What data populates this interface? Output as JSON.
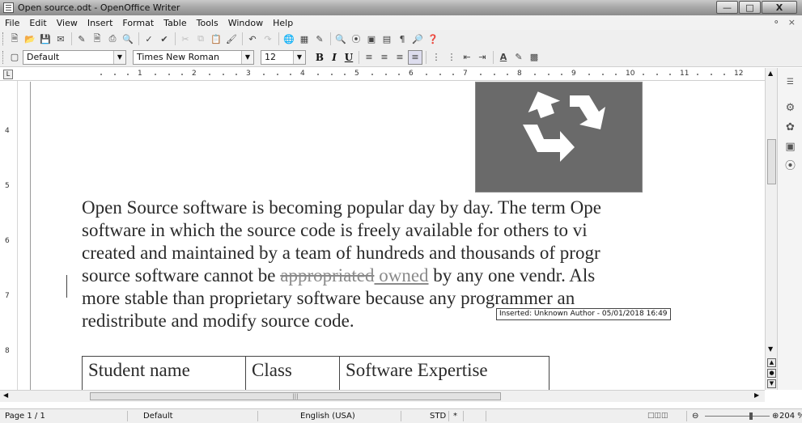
{
  "window": {
    "title": "Open source.odt - OpenOffice Writer",
    "buttons": [
      "—",
      "□",
      "X"
    ]
  },
  "menu": {
    "items": [
      "File",
      "Edit",
      "View",
      "Insert",
      "Format",
      "Table",
      "Tools",
      "Window",
      "Help"
    ],
    "right_icons": [
      "⚬",
      "×"
    ]
  },
  "toolbar": {
    "style_value": "Default",
    "font_value": "Times New Roman",
    "size_value": "12",
    "bold": "B",
    "italic": "I",
    "underline": "U"
  },
  "ruler": {
    "numbers": [
      "1",
      "2",
      "3",
      "4",
      "5",
      "6",
      "7",
      "8",
      "9",
      "10",
      "11",
      "12"
    ],
    "vertical_numbers": [
      "4",
      "5",
      "6",
      "7",
      "8"
    ]
  },
  "document": {
    "lines": [
      "Open Source software is becoming popular day by day.  The term Ope",
      "software in which the source code is freely available for others to vi",
      "created and maintained by a team of hundreds and thousands of progr"
    ],
    "line4_before": "source software cannot be ",
    "line4_deleted": "appropriated",
    "line4_inserted": " owned",
    "line4_after": " by any one vendr.  Als",
    "line5": "more stable than proprietary software because any programmer an",
    "line6": "redistribute and modify source code.",
    "tooltip": "Inserted: Unknown Author - 05/01/2018 16:49",
    "table_headers": [
      "Student name",
      "Class",
      "Software Expertise"
    ]
  },
  "statusbar": {
    "page": "Page 1 / 1",
    "style": "Default",
    "language": "English (USA)",
    "mode": "STD",
    "modified": "*",
    "zoom": "204 %"
  }
}
